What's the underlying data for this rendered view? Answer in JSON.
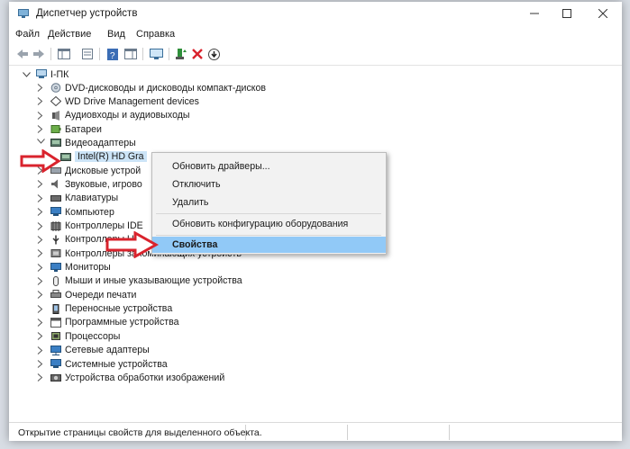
{
  "window": {
    "title": "Диспетчер устройств"
  },
  "menu": [
    "Файл",
    "Действие",
    "Вид",
    "Справка"
  ],
  "tree": {
    "root": "I-ПК",
    "items": [
      {
        "label": "DVD-дисководы и дисководы компакт-дисков",
        "icon": "dvd-drive-icon"
      },
      {
        "label": "WD Drive Management devices",
        "icon": "wd-device-icon"
      },
      {
        "label": "Аудиовходы и аудиовыходы",
        "icon": "audio-io-icon"
      },
      {
        "label": "Батареи",
        "icon": "battery-icon"
      },
      {
        "label": "Видеоадаптеры",
        "icon": "display-adapter-icon",
        "expanded": true
      },
      {
        "label": "Intel(R) HD Gra",
        "icon": "display-adapter-icon",
        "child": true,
        "selected": true
      },
      {
        "label": "Дисковые устрой",
        "icon": "disk-drive-icon"
      },
      {
        "label": "Звуковые, игрово",
        "icon": "sound-icon"
      },
      {
        "label": "Клавиатуры",
        "icon": "keyboard-icon"
      },
      {
        "label": "Компьютер",
        "icon": "computer-icon"
      },
      {
        "label": "Контроллеры IDE",
        "icon": "ide-controller-icon"
      },
      {
        "label": "Контроллеры US",
        "icon": "usb-controller-icon"
      },
      {
        "label": "Контроллеры запоминающих устройств",
        "icon": "storage-controller-icon"
      },
      {
        "label": "Мониторы",
        "icon": "monitor-icon"
      },
      {
        "label": "Мыши и иные указывающие устройства",
        "icon": "mouse-icon"
      },
      {
        "label": "Очереди печати",
        "icon": "printer-icon"
      },
      {
        "label": "Переносные устройства",
        "icon": "portable-device-icon"
      },
      {
        "label": "Программные устройства",
        "icon": "software-device-icon"
      },
      {
        "label": "Процессоры",
        "icon": "processor-icon"
      },
      {
        "label": "Сетевые адаптеры",
        "icon": "network-adapter-icon"
      },
      {
        "label": "Системные устройства",
        "icon": "system-device-icon"
      },
      {
        "label": "Устройства обработки изображений",
        "icon": "imaging-device-icon"
      }
    ]
  },
  "context_menu": {
    "update": "Обновить драйверы...",
    "disable": "Отключить",
    "uninstall": "Удалить",
    "scan": "Обновить конфигурацию оборудования",
    "properties": "Свойства"
  },
  "status": {
    "text": "Открытие страницы свойств для выделенного объекта."
  },
  "colors": {
    "arrow": "#d9232d",
    "highlight": "#91c9f7",
    "selection": "#cce4f7"
  }
}
